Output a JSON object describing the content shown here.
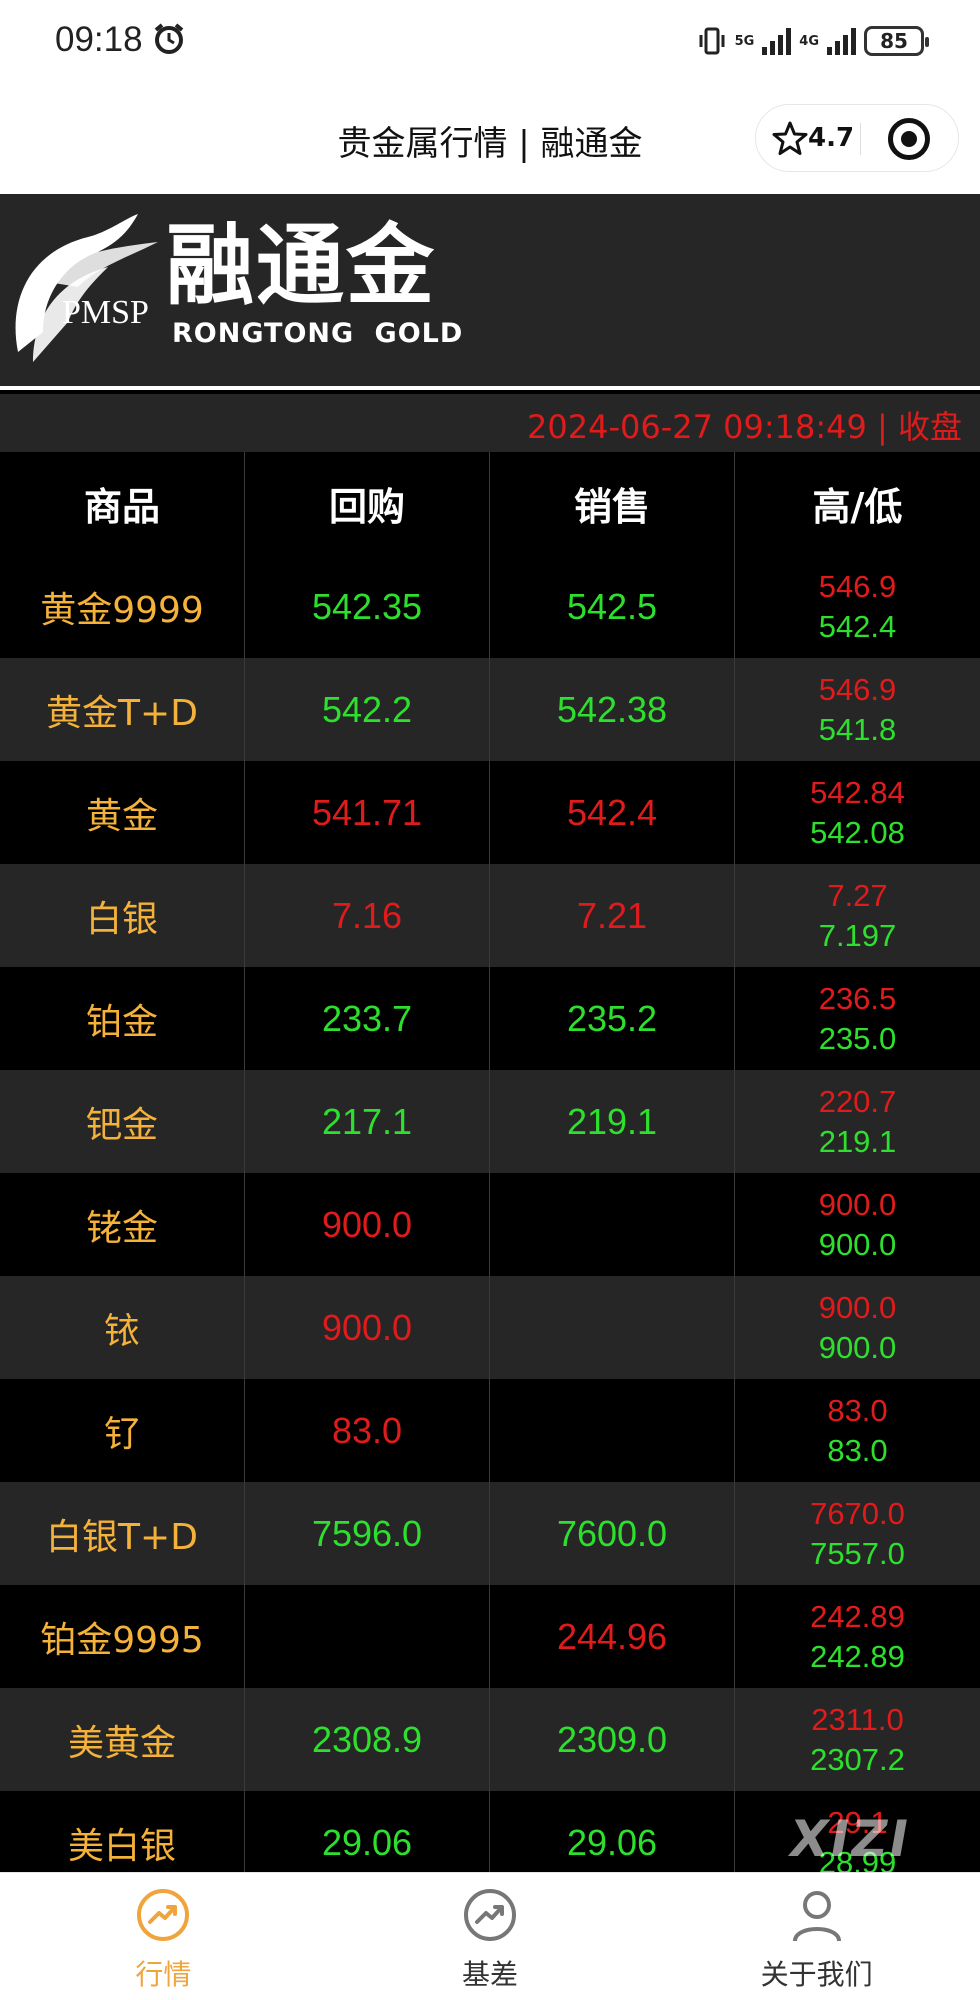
{
  "status_bar": {
    "time": "09:18",
    "network_1": "5G",
    "network_2": "4G",
    "battery": "85"
  },
  "title_bar": {
    "title": "贵金属行情 | 融通金",
    "rating": "4.7"
  },
  "banner": {
    "logo_cn": "融通金",
    "logo_pmsp": "PMSP",
    "logo_en": "RONGTONG GOLD"
  },
  "datebar": {
    "text": "2024-06-27 09:18:49 | 收盘"
  },
  "table": {
    "headers": [
      "商品",
      "回购",
      "销售",
      "高/低"
    ],
    "rows": [
      {
        "name": "黄金9999",
        "buy": "542.35",
        "buy_color": "green",
        "sell": "542.5",
        "sell_color": "green",
        "high": "546.9",
        "low": "542.4"
      },
      {
        "name": "黄金T+D",
        "buy": "542.2",
        "buy_color": "green",
        "sell": "542.38",
        "sell_color": "green",
        "high": "546.9",
        "low": "541.8"
      },
      {
        "name": "黄金",
        "buy": "541.71",
        "buy_color": "red",
        "sell": "542.4",
        "sell_color": "red",
        "high": "542.84",
        "low": "542.08"
      },
      {
        "name": "白银",
        "buy": "7.16",
        "buy_color": "red",
        "sell": "7.21",
        "sell_color": "red",
        "high": "7.27",
        "low": "7.197"
      },
      {
        "name": "铂金",
        "buy": "233.7",
        "buy_color": "green",
        "sell": "235.2",
        "sell_color": "green",
        "high": "236.5",
        "low": "235.0"
      },
      {
        "name": "钯金",
        "buy": "217.1",
        "buy_color": "green",
        "sell": "219.1",
        "sell_color": "green",
        "high": "220.7",
        "low": "219.1"
      },
      {
        "name": "铑金",
        "buy": "900.0",
        "buy_color": "red",
        "sell": "",
        "sell_color": "red",
        "high": "900.0",
        "low": "900.0"
      },
      {
        "name": "铱",
        "buy": "900.0",
        "buy_color": "red",
        "sell": "",
        "sell_color": "red",
        "high": "900.0",
        "low": "900.0"
      },
      {
        "name": "钌",
        "buy": "83.0",
        "buy_color": "red",
        "sell": "",
        "sell_color": "red",
        "high": "83.0",
        "low": "83.0"
      },
      {
        "name": "白银T+D",
        "buy": "7596.0",
        "buy_color": "green",
        "sell": "7600.0",
        "sell_color": "green",
        "high": "7670.0",
        "low": "7557.0"
      },
      {
        "name": "铂金9995",
        "buy": "",
        "buy_color": "red",
        "sell": "244.96",
        "sell_color": "red",
        "high": "242.89",
        "low": "242.89"
      },
      {
        "name": "美黄金",
        "buy": "2308.9",
        "buy_color": "green",
        "sell": "2309.0",
        "sell_color": "green",
        "high": "2311.0",
        "low": "2307.2"
      },
      {
        "name": "美白银",
        "buy": "29.06",
        "buy_color": "green",
        "sell": "29.06",
        "sell_color": "green",
        "high": "29.1",
        "low": "28.99"
      }
    ]
  },
  "watermark": "XIZI",
  "bottom_nav": {
    "items": [
      {
        "label": "行情",
        "active": true
      },
      {
        "label": "基差",
        "active": false
      },
      {
        "label": "关于我们",
        "active": false
      }
    ]
  },
  "colors": {
    "up_red": "#e01b1b",
    "down_green": "#2ee02e",
    "name_gold": "#f5b23a",
    "nav_active": "#f0a43c"
  }
}
